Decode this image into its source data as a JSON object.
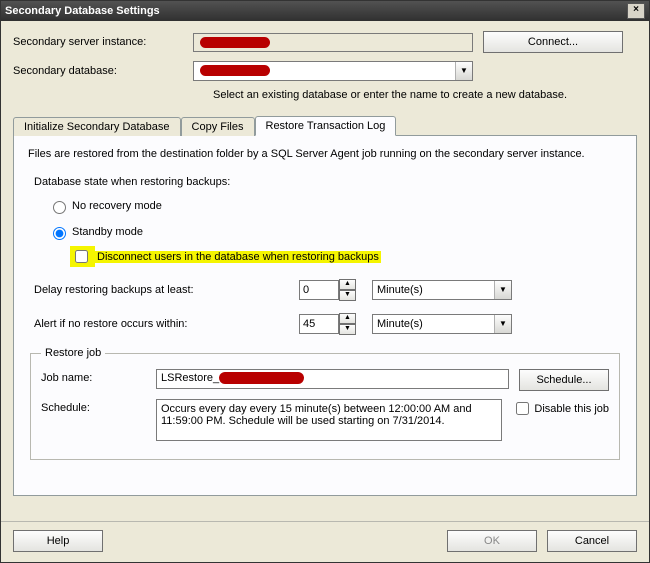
{
  "window": {
    "title": "Secondary Database Settings"
  },
  "server_instance": {
    "label": "Secondary server instance:",
    "value": "",
    "connect_button": "Connect..."
  },
  "database": {
    "label": "Secondary database:",
    "value": "",
    "help": "Select an existing database or enter the name to create a new database."
  },
  "tabs": {
    "init": "Initialize Secondary Database",
    "copy": "Copy Files",
    "restore": "Restore Transaction Log"
  },
  "restore": {
    "intro": "Files are restored from the destination folder by a SQL Server Agent job running on the secondary server instance.",
    "state_heading": "Database state when restoring backups:",
    "no_recovery": "No recovery mode",
    "standby": "Standby mode",
    "disconnect": "Disconnect users in the database when restoring backups",
    "delay_label": "Delay restoring backups at least:",
    "delay_value": "0",
    "delay_unit": "Minute(s)",
    "alert_label": "Alert if no restore occurs within:",
    "alert_value": "45",
    "alert_unit": "Minute(s)"
  },
  "restore_job": {
    "legend": "Restore job",
    "jobname_label": "Job name:",
    "jobname_value": "LSRestore_",
    "schedule_button": "Schedule...",
    "schedule_label": "Schedule:",
    "schedule_text": "Occurs every day every 15 minute(s) between 12:00:00 AM and 11:59:00 PM. Schedule will be used starting on 7/31/2014.",
    "disable_label": "Disable this job"
  },
  "footer": {
    "help": "Help",
    "ok": "OK",
    "cancel": "Cancel"
  }
}
